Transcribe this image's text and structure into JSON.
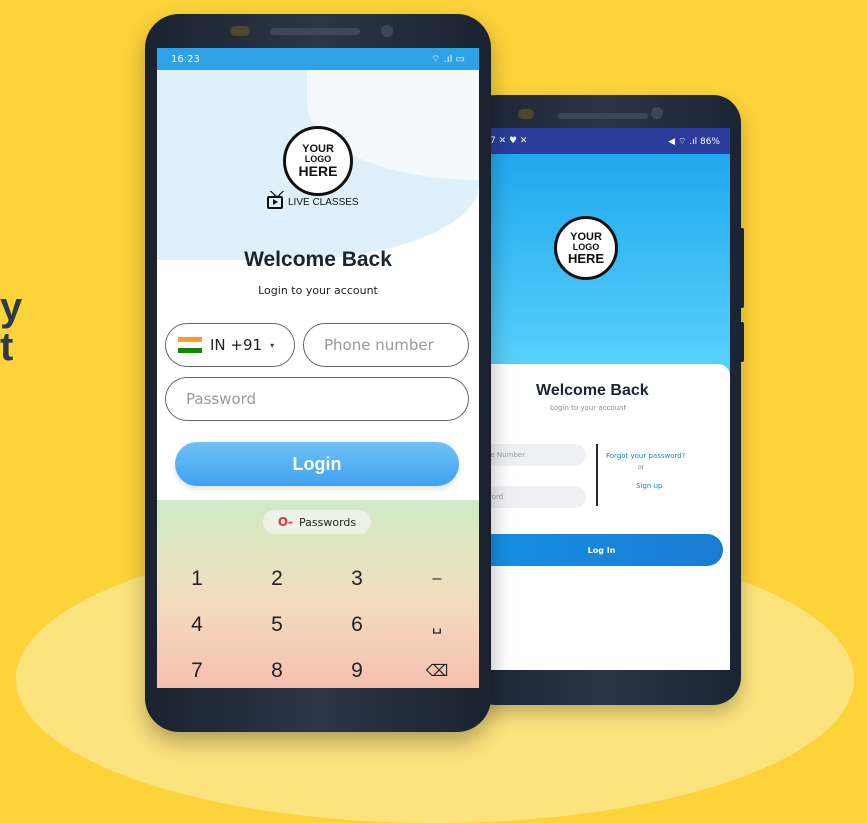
{
  "background_color": "#FDD33A",
  "side_text": {
    "line1": "y",
    "line2": "t"
  },
  "back_phone": {
    "status_left": "7 ✕ ♥ ✕",
    "status_right": "◀ ⌔ .ıl 86%",
    "logo": [
      "YOUR",
      "LOGO",
      "HERE"
    ],
    "title": "Welcome Back",
    "subtitle": "Login to your account",
    "phone_placeholder": "ne Number",
    "password_placeholder": "word",
    "forgot_password": "Forgot your password?",
    "or": "or",
    "sign_up": "Sign up",
    "login_button": "Log In"
  },
  "front_phone": {
    "status_time": "16:23",
    "status_right": "⌔ .ıl ▭",
    "logo": [
      "YOUR",
      "LOGO",
      "HERE"
    ],
    "live_classes": "LIVE CLASSES",
    "title": "Welcome Back",
    "subtitle": "Login to your account",
    "country_code": "IN +91",
    "phone_placeholder": "Phone number",
    "password_placeholder": "Password",
    "login_button": "Login",
    "passwords_chip": "Passwords",
    "keypad": [
      [
        "1",
        "2",
        "3",
        "–"
      ],
      [
        "4",
        "5",
        "6",
        "␣"
      ],
      [
        "7",
        "8",
        "9",
        "⌫"
      ]
    ],
    "accent_color": "#3FA2EE"
  }
}
